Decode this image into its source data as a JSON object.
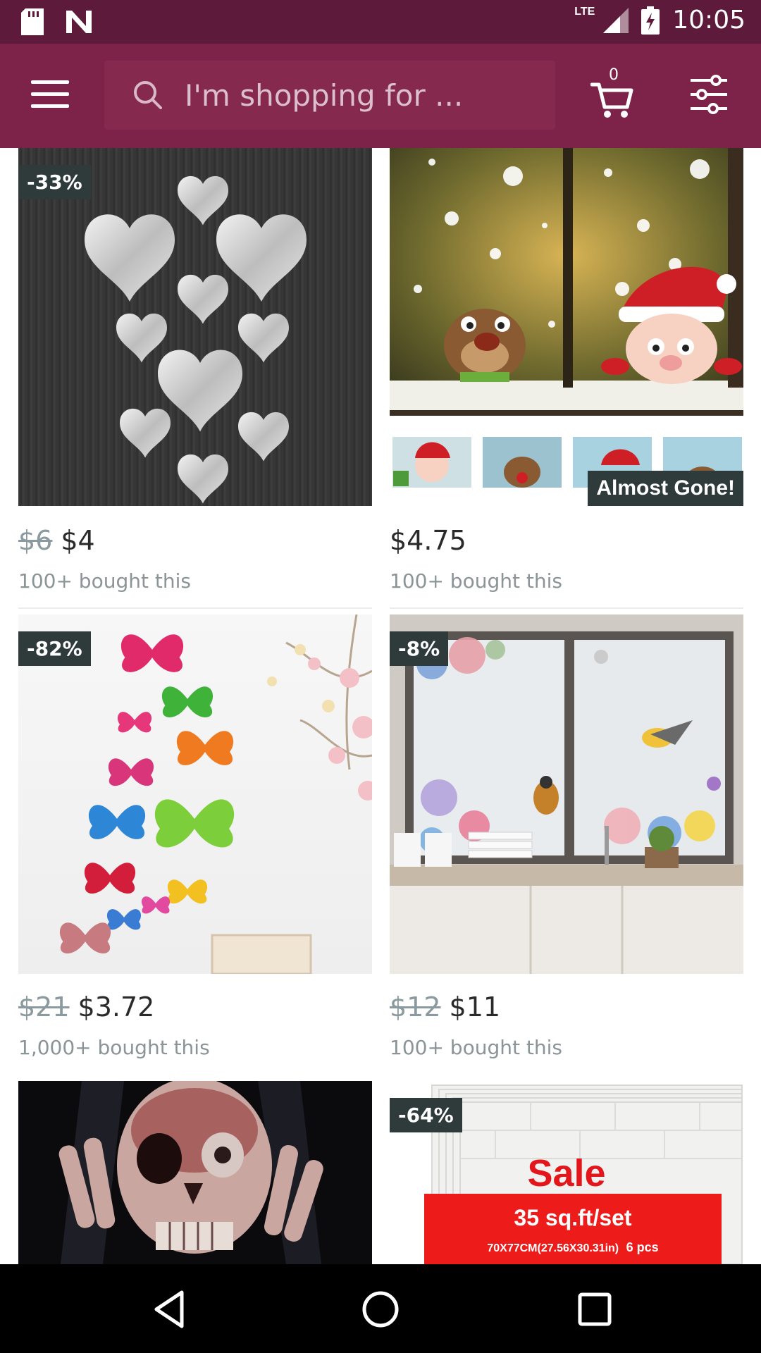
{
  "status_bar": {
    "time": "10:05",
    "network": "LTE",
    "icons": [
      "sd-card-icon",
      "n-notification-icon",
      "signal-icon",
      "battery-charging-icon"
    ]
  },
  "header": {
    "search_placeholder": "I'm shopping for ...",
    "cart_count": "0",
    "icons": [
      "menu-icon",
      "search-icon",
      "cart-icon",
      "filter-icon"
    ]
  },
  "products": [
    {
      "badge": "-33%",
      "old_price": "$6",
      "price": "$4",
      "bought": "100+ bought this",
      "image": "mirror heart stickers"
    },
    {
      "badge": "",
      "old_price": "",
      "price": "$4.75",
      "bought": "100+ bought this",
      "image": "christmas window stickers",
      "tag": "Almost Gone!"
    },
    {
      "badge": "-82%",
      "old_price": "$21",
      "price": "$3.72",
      "bought": "1,000+ bought this",
      "image": "3D butterfly wall stickers"
    },
    {
      "badge": "-8%",
      "old_price": "$12",
      "price": "$11",
      "bought": "100+ bought this",
      "image": "floral bird window film"
    },
    {
      "badge": "",
      "old_price": "",
      "price": "",
      "bought": "",
      "image": "skull wall decal"
    },
    {
      "badge": "-64%",
      "old_price": "",
      "price": "",
      "bought": "",
      "image": "3D brick wall panels",
      "sale_title": "Sale",
      "sale_line1": "35 sq.ft/set",
      "sale_line2": "70X77CM(27.56X30.31in)",
      "sale_line3": "6 pcs"
    }
  ],
  "nav_bar": {
    "icons": [
      "back-icon",
      "home-icon",
      "recents-icon"
    ]
  }
}
